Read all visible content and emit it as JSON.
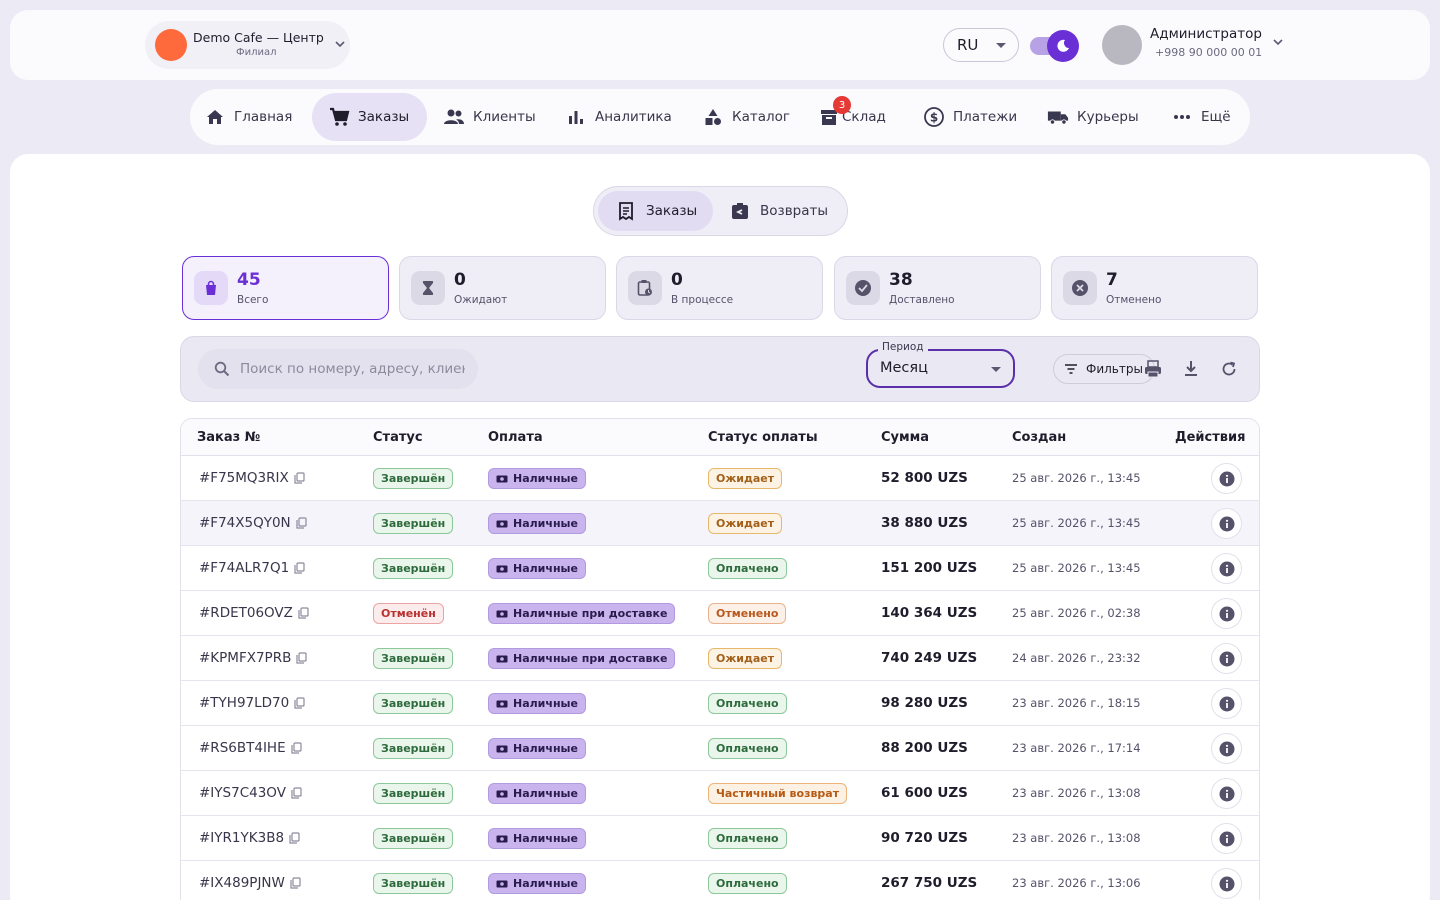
{
  "header": {
    "branch_name": "Demo Cafe — Центр",
    "branch_sub": "Филиал",
    "language": "RU",
    "user_name": "Администратор",
    "user_phone": "+998 90 000 00 01",
    "brand_color": "#6b2fd6",
    "branch_color": "#ff6a3d"
  },
  "nav": {
    "items": [
      {
        "label": "Главная",
        "icon": "home-icon"
      },
      {
        "label": "Заказы",
        "icon": "cart-icon",
        "active": true
      },
      {
        "label": "Клиенты",
        "icon": "people-icon"
      },
      {
        "label": "Аналитика",
        "icon": "bar-chart-icon"
      },
      {
        "label": "Каталог",
        "icon": "category-icon"
      },
      {
        "label": "Склад",
        "icon": "inventory-icon",
        "badge": "3"
      },
      {
        "label": "Платежи",
        "icon": "dollar-icon"
      },
      {
        "label": "Курьеры",
        "icon": "truck-icon"
      },
      {
        "label": "Ещё",
        "icon": "more-icon"
      }
    ]
  },
  "segments": [
    {
      "label": "Заказы",
      "active": true
    },
    {
      "label": "Возвраты"
    }
  ],
  "stats": [
    {
      "value": "45",
      "label": "Всего",
      "icon": "bag-icon",
      "active": true
    },
    {
      "value": "0",
      "label": "Ожидают",
      "icon": "hourglass-icon"
    },
    {
      "value": "0",
      "label": "В процессе",
      "icon": "clipboard-clock-icon"
    },
    {
      "value": "38",
      "label": "Доставлено",
      "icon": "check-circle-icon"
    },
    {
      "value": "7",
      "label": "Отменено",
      "icon": "cancel-circle-icon"
    }
  ],
  "toolbar": {
    "search_placeholder": "Поиск по номеру, адресу, клиенту",
    "period_label": "Период",
    "period_value": "Месяц",
    "filters_label": "Фильтры"
  },
  "table": {
    "headers": [
      "Заказ №",
      "Статус",
      "Оплата",
      "Статус оплаты",
      "Сумма",
      "Создан",
      "Действия"
    ],
    "rows": [
      {
        "id": "#F75MQ3RIX",
        "status": "Завершён",
        "status_type": "done",
        "payment": "Наличные",
        "pay_status": "Ожидает",
        "pay_type": "wait",
        "sum": "52 800 UZS",
        "created": "25 авг. 2026 г., 13:45"
      },
      {
        "id": "#F74X5QY0N",
        "status": "Завершён",
        "status_type": "done",
        "payment": "Наличные",
        "pay_status": "Ожидает",
        "pay_type": "wait",
        "sum": "38 880 UZS",
        "created": "25 авг. 2026 г., 13:45",
        "highlight": true
      },
      {
        "id": "#F74ALR7Q1",
        "status": "Завершён",
        "status_type": "done",
        "payment": "Наличные",
        "pay_status": "Оплачено",
        "pay_type": "paid",
        "sum": "151 200 UZS",
        "created": "25 авг. 2026 г., 13:45"
      },
      {
        "id": "#RDET06OVZ",
        "status": "Отменён",
        "status_type": "cancel",
        "payment": "Наличные при доставке",
        "pay_status": "Отменено",
        "pay_type": "cancel",
        "sum": "140 364 UZS",
        "created": "25 авг. 2026 г., 02:38"
      },
      {
        "id": "#KPMFX7PRB",
        "status": "Завершён",
        "status_type": "done",
        "payment": "Наличные при доставке",
        "pay_status": "Ожидает",
        "pay_type": "wait",
        "sum": "740 249 UZS",
        "created": "24 авг. 2026 г., 23:32"
      },
      {
        "id": "#TYH97LD70",
        "status": "Завершён",
        "status_type": "done",
        "payment": "Наличные",
        "pay_status": "Оплачено",
        "pay_type": "paid",
        "sum": "98 280 UZS",
        "created": "23 авг. 2026 г., 18:15"
      },
      {
        "id": "#RS6BT4IHE",
        "status": "Завершён",
        "status_type": "done",
        "payment": "Наличные",
        "pay_status": "Оплачено",
        "pay_type": "paid",
        "sum": "88 200 UZS",
        "created": "23 авг. 2026 г., 17:14"
      },
      {
        "id": "#IYS7C43OV",
        "status": "Завершён",
        "status_type": "done",
        "payment": "Наличные",
        "pay_status": "Частичный возврат",
        "pay_type": "partial",
        "sum": "61 600 UZS",
        "created": "23 авг. 2026 г., 13:08"
      },
      {
        "id": "#IYR1YK3B8",
        "status": "Завершён",
        "status_type": "done",
        "payment": "Наличные",
        "pay_status": "Оплачено",
        "pay_type": "paid",
        "sum": "90 720 UZS",
        "created": "23 авг. 2026 г., 13:08"
      },
      {
        "id": "#IX489PJNW",
        "status": "Завершён",
        "status_type": "done",
        "payment": "Наличные",
        "pay_status": "Оплачено",
        "pay_type": "paid",
        "sum": "267 750 UZS",
        "created": "23 авг. 2026 г., 13:06"
      }
    ]
  }
}
